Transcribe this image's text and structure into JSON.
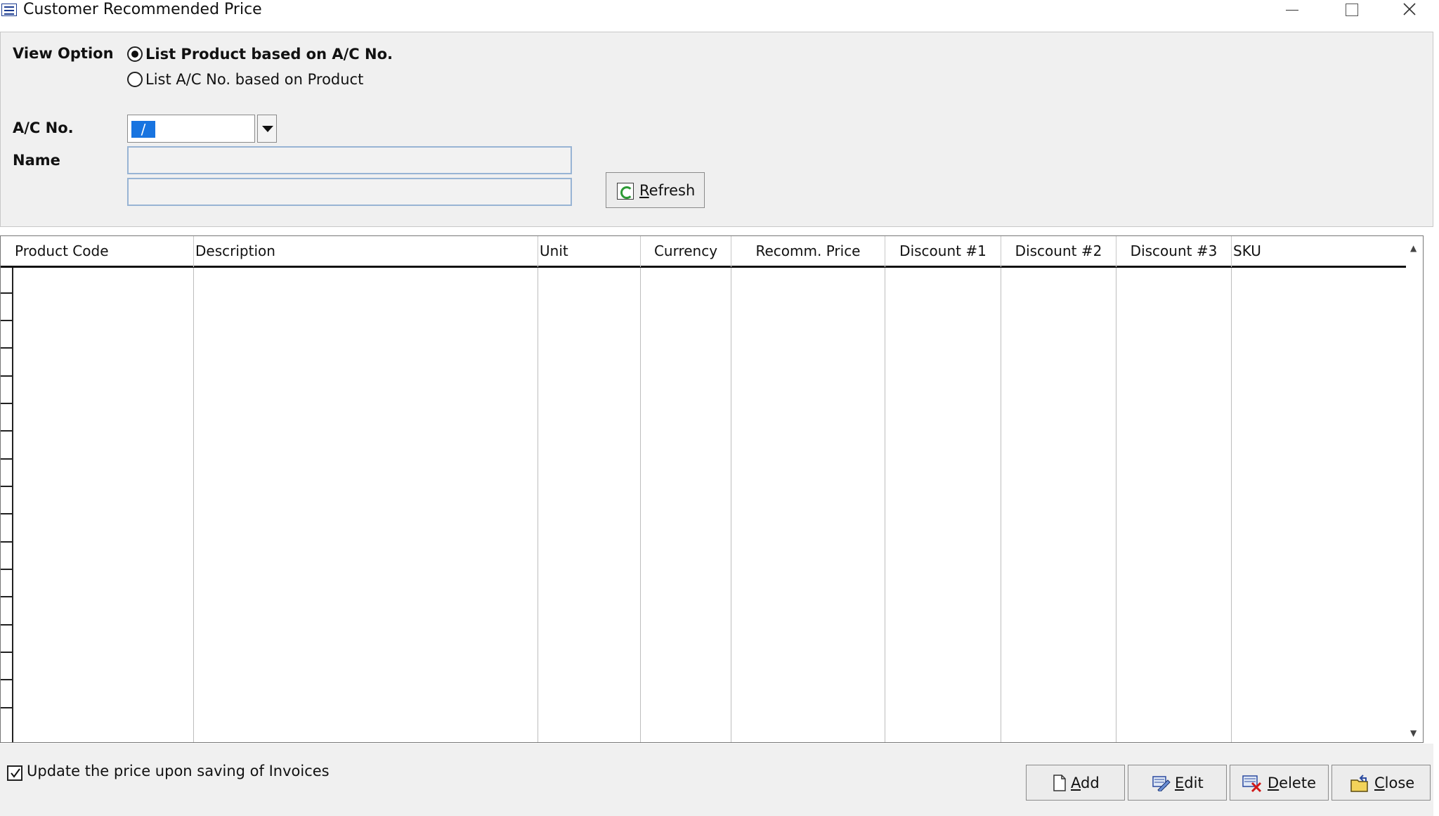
{
  "window": {
    "title": "Customer Recommended Price",
    "icon": "table-app-icon"
  },
  "view_option": {
    "label": "View Option",
    "options": [
      {
        "label": "List Product based on A/C No.",
        "selected": true
      },
      {
        "label": "List A/C No. based on Product",
        "selected": false
      }
    ]
  },
  "account": {
    "label": "A/C No.",
    "value": "/",
    "name_label": "Name",
    "name_line1": "",
    "name_line2": ""
  },
  "refresh": {
    "label": "Refresh",
    "icon": "refresh-icon"
  },
  "grid": {
    "columns": [
      "Product Code",
      "Description",
      "Unit",
      "Currency",
      "Recomm. Price",
      "Discount #1",
      "Discount #2",
      "Discount #3",
      "SKU"
    ],
    "rows": []
  },
  "update_option": {
    "label": "Update the price upon saving of Invoices",
    "checked": true
  },
  "actions": {
    "add": "Add",
    "edit": "Edit",
    "delete": "Delete",
    "close": "Close"
  },
  "colors": {
    "selection": "#1874e0",
    "panel_bg": "#f0f0f0",
    "field_border": "#98b4d4"
  }
}
